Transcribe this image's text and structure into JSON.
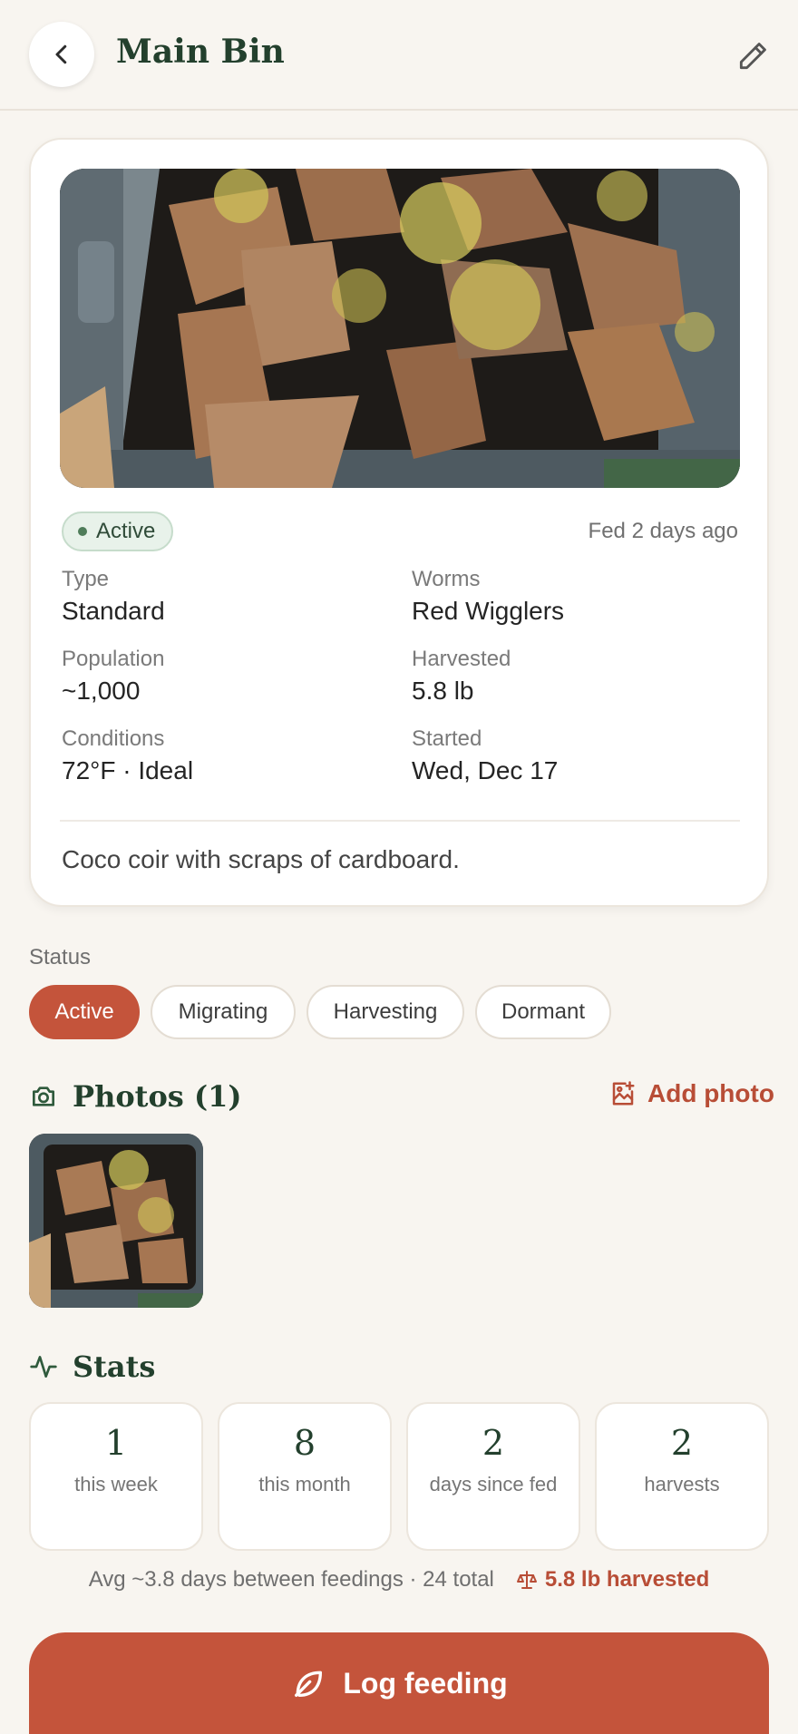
{
  "header": {
    "title": "Main Bin",
    "back_icon": "chevron-left-icon",
    "edit_icon": "pencil-icon"
  },
  "bin": {
    "status_badge": "Active",
    "fed_ago": "Fed 2 days ago",
    "fields": [
      {
        "label": "Type",
        "value": "Standard"
      },
      {
        "label": "Worms",
        "value": "Red Wigglers"
      },
      {
        "label": "Population",
        "value": "~1,000"
      },
      {
        "label": "Harvested",
        "value": "5.8 lb"
      },
      {
        "label": "Conditions",
        "value": "72°F · Ideal"
      },
      {
        "label": "Started",
        "value": "Wed, Dec 17"
      }
    ],
    "notes": "Coco coir with scraps of cardboard."
  },
  "status_section": {
    "label": "Status",
    "options": [
      "Active",
      "Migrating",
      "Harvesting",
      "Dormant"
    ],
    "selected": "Active"
  },
  "photos": {
    "title": "Photos (1)",
    "add_label": "Add photo"
  },
  "stats": {
    "title": "Stats",
    "cards": [
      {
        "value": "1",
        "caption": "this week"
      },
      {
        "value": "8",
        "caption": "this month"
      },
      {
        "value": "2",
        "caption": "days since fed"
      },
      {
        "value": "2",
        "caption": "harvests"
      }
    ],
    "summary": "Avg ~3.8 days between feedings · 24 total",
    "harvest_total": "5.8 lb harvested"
  },
  "log_button": {
    "label": "Log feeding"
  },
  "colors": {
    "accent": "#c4543b",
    "brand_green": "#23402d",
    "background": "#f8f5f0"
  }
}
